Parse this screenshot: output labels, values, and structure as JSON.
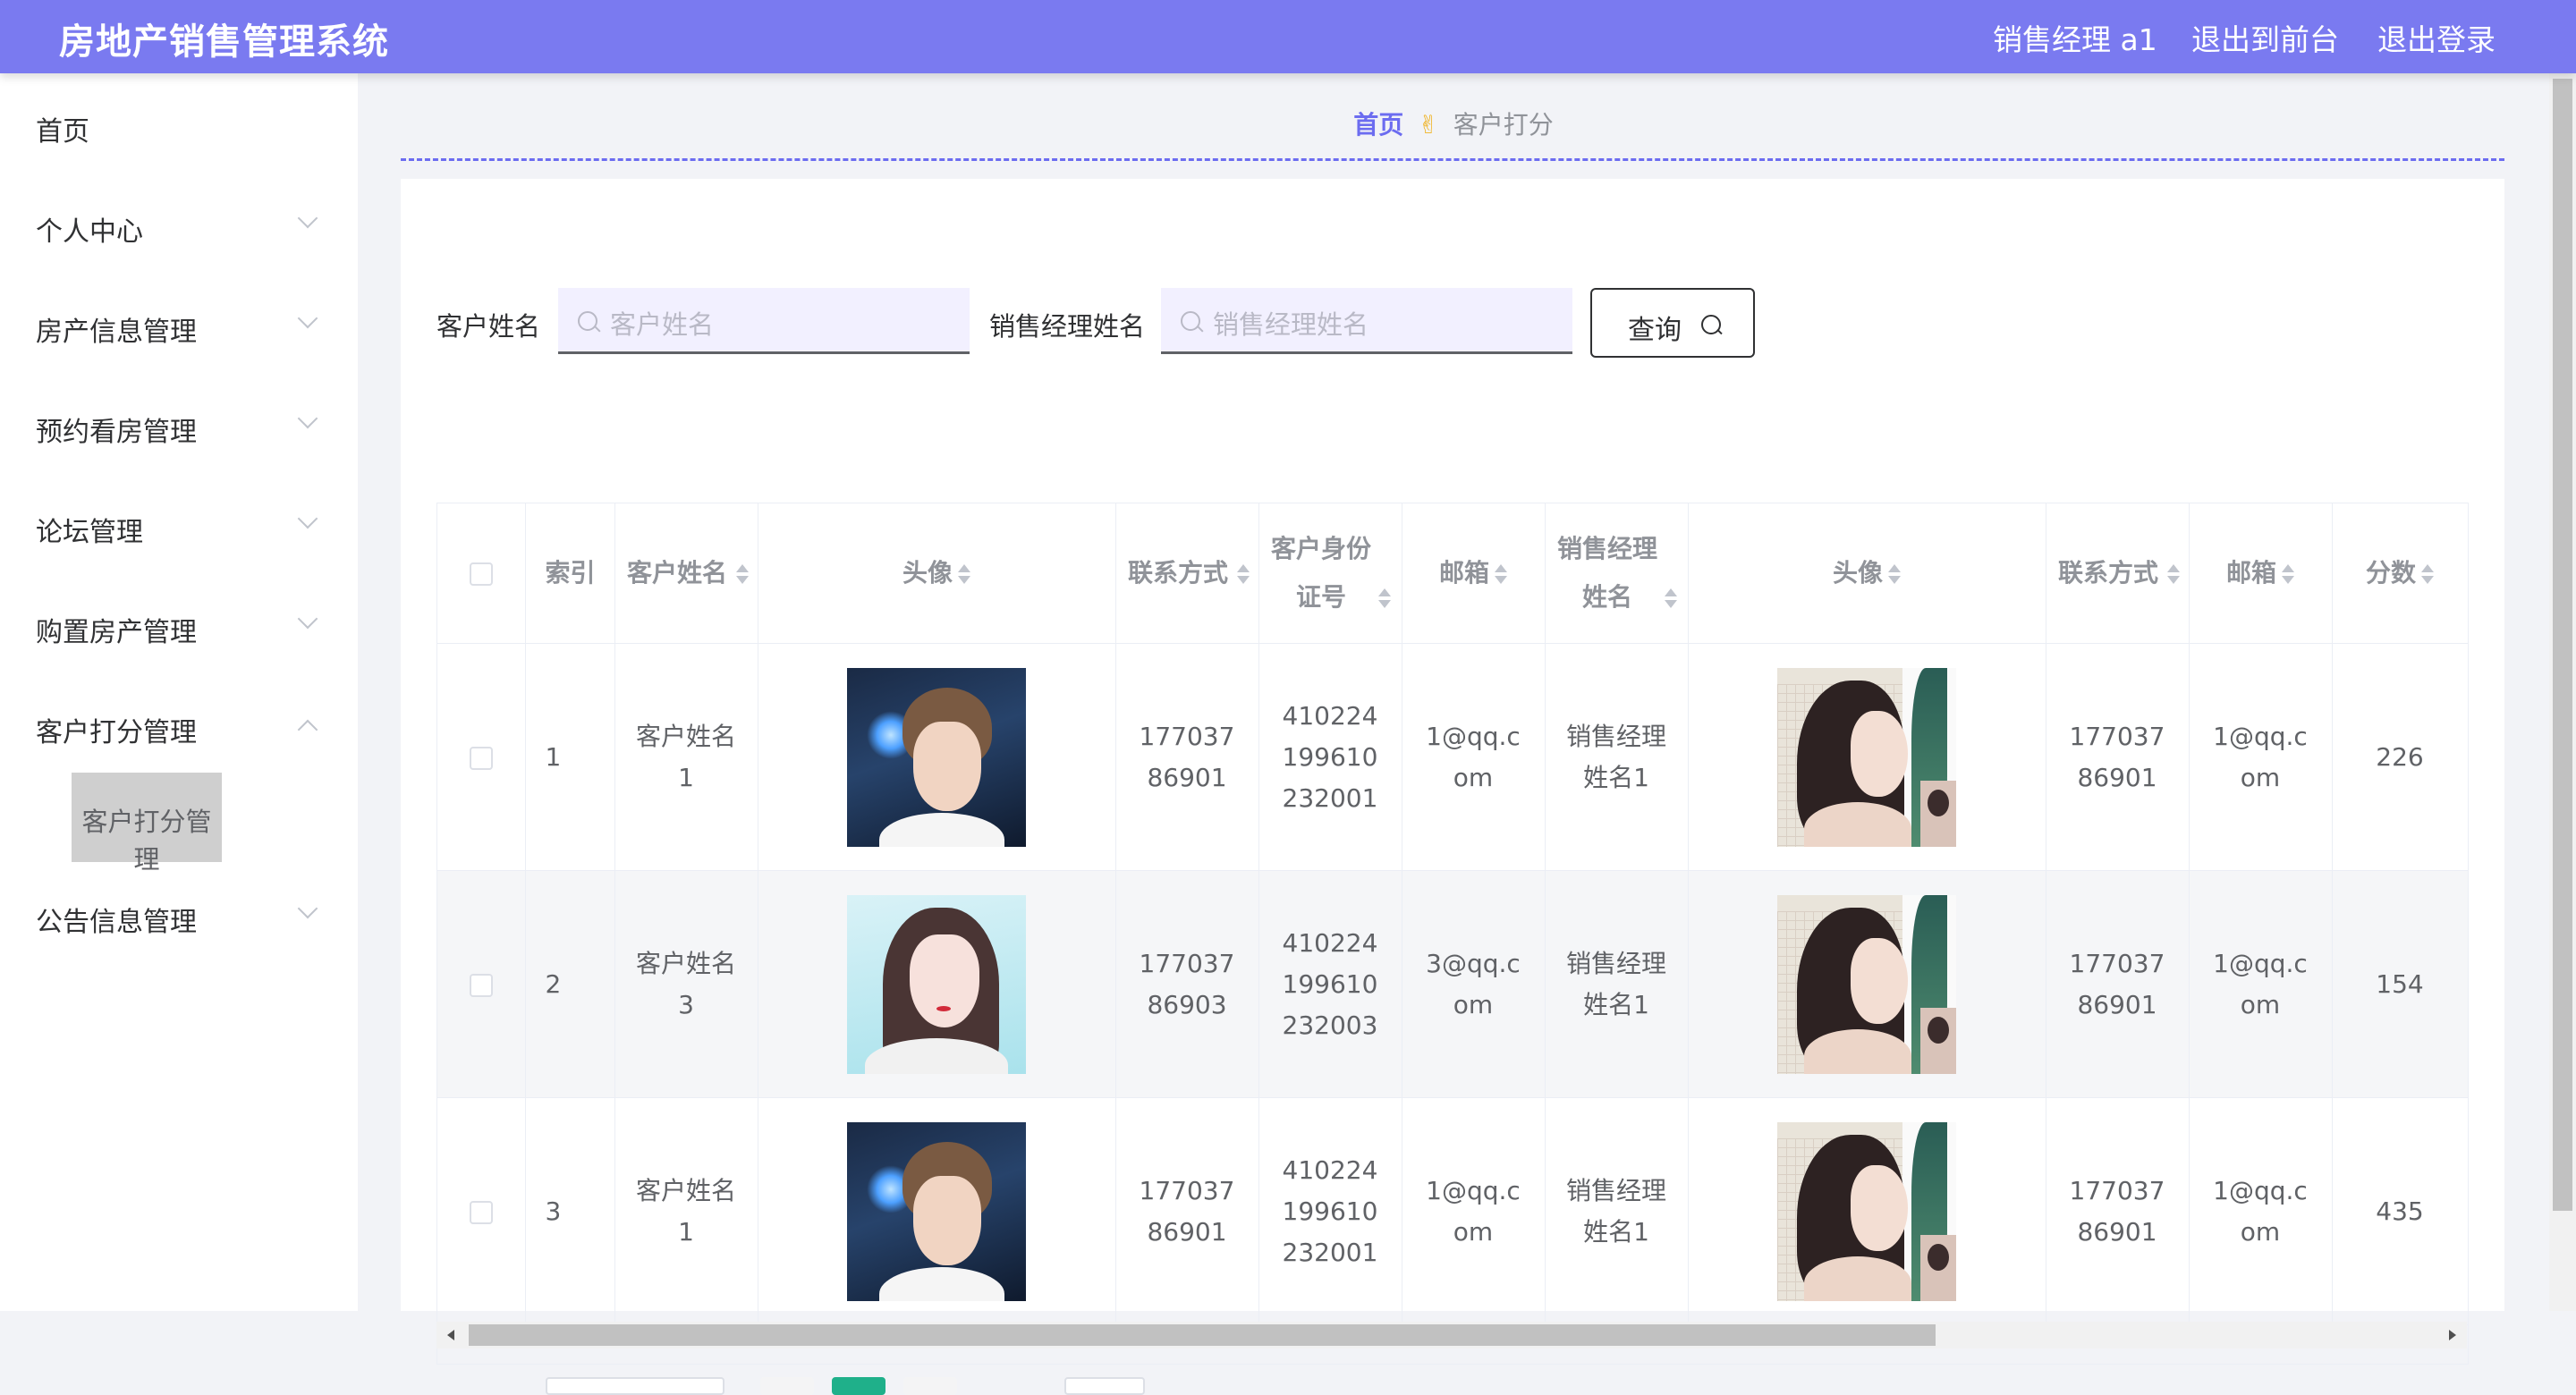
{
  "app": {
    "title": "房地产销售管理系统"
  },
  "header": {
    "user": "销售经理 a1",
    "to_front": "退出到前台",
    "logout": "退出登录"
  },
  "sidebar": {
    "items": [
      {
        "label": "首页"
      },
      {
        "label": "个人中心"
      },
      {
        "label": "房产信息管理"
      },
      {
        "label": "预约看房管理"
      },
      {
        "label": "论坛管理"
      },
      {
        "label": "购置房产管理"
      },
      {
        "label": "客户打分管理"
      },
      {
        "label": "公告信息管理"
      }
    ],
    "active_sub": "客户打分管理"
  },
  "breadcrumb": {
    "home": "首页",
    "current": "客户打分"
  },
  "search": {
    "customer_label": "客户姓名",
    "customer_placeholder": "客户姓名",
    "manager_label": "销售经理姓名",
    "manager_placeholder": "销售经理姓名",
    "query_label": "查询"
  },
  "table": {
    "headers": {
      "index": "索引",
      "customer_name": "客户姓名",
      "avatar": "头像",
      "contact": "联系方式",
      "id_card": "客户身份证号",
      "email": "邮箱",
      "manager_name": "销售经理姓名",
      "manager_avatar": "头像",
      "manager_contact": "联系方式",
      "manager_email": "邮箱",
      "score": "分数"
    },
    "rows": [
      {
        "index": "1",
        "customer_name": "客户姓名1",
        "avatar": "boy",
        "contact": "17703786901",
        "id_card": "410224199610232001",
        "email": "1@qq.com",
        "manager_name": "销售经理姓名1",
        "manager_avatar": "girl",
        "manager_contact": "17703786901",
        "manager_email": "1@qq.com",
        "score": "226"
      },
      {
        "index": "2",
        "customer_name": "客户姓名3",
        "avatar": "girl-hand",
        "contact": "17703786903",
        "id_card": "410224199610232003",
        "email": "3@qq.com",
        "manager_name": "销售经理姓名1",
        "manager_avatar": "girl",
        "manager_contact": "17703786901",
        "manager_email": "1@qq.com",
        "score": "154"
      },
      {
        "index": "3",
        "customer_name": "客户姓名1",
        "avatar": "boy",
        "contact": "17703786901",
        "id_card": "410224199610232001",
        "email": "1@qq.com",
        "manager_name": "销售经理姓名1",
        "manager_avatar": "girl",
        "manager_contact": "17703786901",
        "manager_email": "1@qq.com",
        "score": "435"
      }
    ]
  },
  "colors": {
    "header_bg": "#7a7af0",
    "accent": "#6c6cf0",
    "pagination_active": "#1fb08a"
  }
}
